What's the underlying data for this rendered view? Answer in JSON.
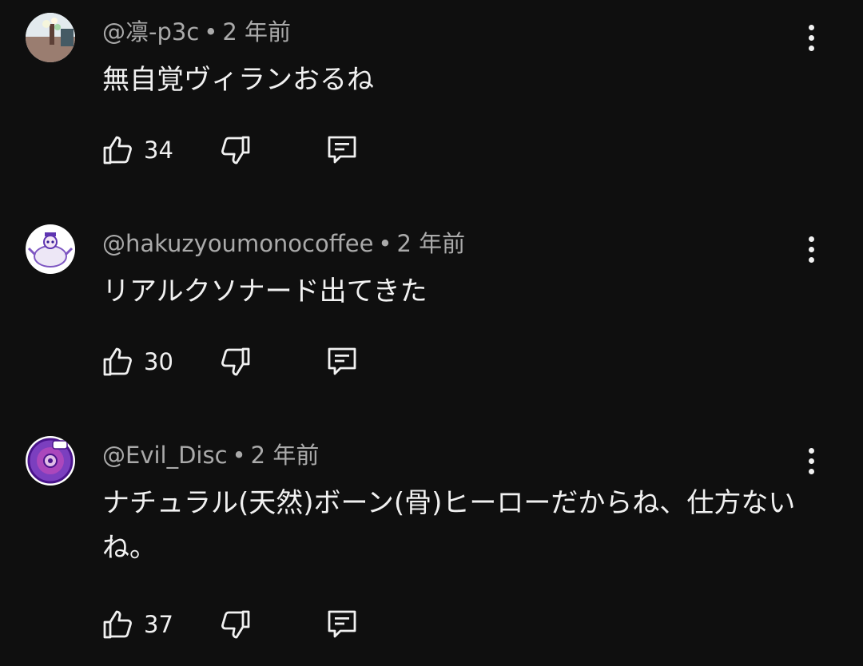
{
  "comments": [
    {
      "author": "@凛-p3c",
      "separator": "•",
      "time": "2 年前",
      "text": "無自覚ヴィランおるね",
      "likes": "34",
      "avatar_icon": "photo-avatar-flowers",
      "colors": {
        "avatar_bg": "#cfd8dc",
        "avatar_accent": "#8d6e63"
      }
    },
    {
      "author": "@hakuzyoumonocoffee",
      "separator": "•",
      "time": "2 年前",
      "text": "リアルクソナード出てきた",
      "likes": "30",
      "avatar_icon": "character-avatar-white",
      "colors": {
        "avatar_bg": "#ffffff",
        "avatar_accent": "#7e57c2"
      }
    },
    {
      "author": "@Evil_Disc",
      "separator": "•",
      "time": "2 年前",
      "text": "ナチュラル(天然)ボーン(骨)ヒーローだからね、仕方ないね。",
      "likes": "37",
      "avatar_icon": "purple-disc-avatar",
      "colors": {
        "avatar_bg": "#7b3fbf",
        "avatar_accent": "#e1bee7"
      }
    }
  ],
  "icons": {
    "like": "thumbs-up-icon",
    "dislike": "thumbs-down-icon",
    "reply": "reply-comment-icon",
    "more": "more-vertical-icon"
  },
  "theme": {
    "background": "#0f0f0f",
    "primary_text": "#f1f1f1",
    "secondary_text": "#aaaaaa"
  }
}
